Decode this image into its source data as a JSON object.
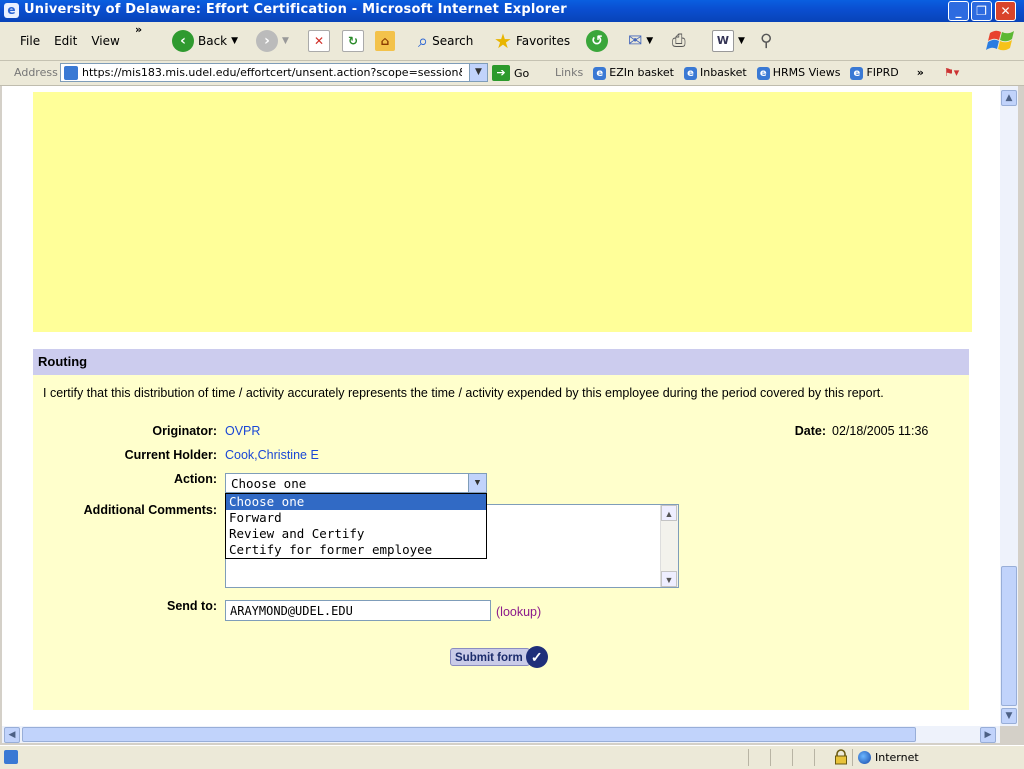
{
  "window": {
    "title": "University of Delaware: Effort Certification - Microsoft Internet Explorer"
  },
  "menu": {
    "file": "File",
    "edit": "Edit",
    "view": "View"
  },
  "toolbar": {
    "back_label": "Back",
    "search_label": "Search",
    "favorites_label": "Favorites"
  },
  "addressbar": {
    "label": "Address",
    "url": "https://mis183.mis.udel.edu/effortcert/unsent.action?scope=session&obj",
    "go_label": "Go",
    "links_label": "Links",
    "links": [
      "EZIn basket",
      "Inbasket",
      "HRMS Views",
      "FIPRD"
    ]
  },
  "routing": {
    "header": "Routing",
    "certify_text": "I certify that this distribution of time / activity accurately represents the time / activity expended by this employee during the period covered by this report.",
    "originator_label": "Originator:",
    "originator_value": "OVPR",
    "date_label": "Date:",
    "date_value": "02/18/2005 11:36",
    "holder_label": "Current Holder:",
    "holder_value": "Cook,Christine E",
    "action_label": "Action:",
    "action_selected": "Choose one",
    "action_options": [
      "Choose one",
      "Forward",
      "Review and Certify",
      "Certify for former employee"
    ],
    "comments_label": "Additional Comments:",
    "comments_value": "",
    "sendto_label": "Send to:",
    "sendto_value": "ARAYMOND@UDEL.EDU",
    "lookup_label": "(lookup)",
    "submit_label": "Submit form"
  },
  "status": {
    "zone": "Internet"
  }
}
